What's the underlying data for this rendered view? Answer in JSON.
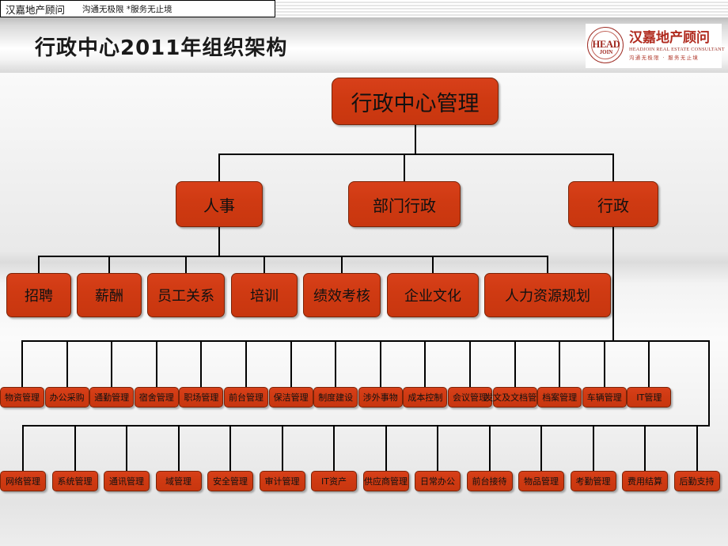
{
  "header": {
    "brand": "汉嘉地产顾问",
    "slogan": "沟通无极限 *服务无止境"
  },
  "title": "行政中心2011年组织架构",
  "logo": {
    "mark_top": "HEAD",
    "mark_bottom": "JOIN",
    "name_cn": "汉嘉地产顾问",
    "name_en": "HEADJOIN REAL ESTATE CONSULTANT",
    "slogan": "沟通无极限 · 服务无止境"
  },
  "colors": {
    "node_fill": "#CF3A12",
    "node_border": "#7A2408",
    "connector": "#000000",
    "title_text": "#1A1A1A",
    "brand_red": "#B02A1E"
  },
  "chart_data": {
    "type": "diagram",
    "title": "行政中心2011年组织架构",
    "levels": [
      {
        "level": 1,
        "nodes": [
          "行政中心管理"
        ]
      },
      {
        "level": 2,
        "nodes": [
          "人事",
          "部门行政",
          "行政"
        ]
      },
      {
        "level": 3,
        "parent": "人事",
        "nodes": [
          "招聘",
          "薪酬",
          "员工关系",
          "培训",
          "绩效考核",
          "企业文化",
          "人力资源规划"
        ]
      },
      {
        "level": 4,
        "parent": "行政",
        "nodes": [
          "物资管理",
          "办公采购",
          "通勤管理",
          "宿舍管理",
          "职场管理",
          "前台管理",
          "保洁管理",
          "制度建设",
          "涉外事物",
          "成本控制",
          "会议管理",
          "发文及文档管理",
          "档案管理",
          "车辆管理",
          "IT管理"
        ]
      },
      {
        "level": 5,
        "parent": "IT管理",
        "nodes": [
          "网络管理",
          "系统管理",
          "通讯管理",
          "域管理",
          "安全管理",
          "审计管理",
          "IT资产",
          "供应商管理",
          "日常办公",
          "前台接待",
          "物品管理",
          "考勤管理",
          "费用结算",
          "后勤支持"
        ]
      }
    ],
    "root": "行政中心管理",
    "level2": [
      {
        "label": "人事"
      },
      {
        "label": "部门行政"
      },
      {
        "label": "行政"
      }
    ],
    "level3": [
      {
        "label": "招聘"
      },
      {
        "label": "薪酬"
      },
      {
        "label": "员工关系"
      },
      {
        "label": "培训"
      },
      {
        "label": "绩效考核"
      },
      {
        "label": "企业文化"
      },
      {
        "label": "人力资源规划"
      }
    ],
    "level4": [
      {
        "label": "物资管理"
      },
      {
        "label": "办公采购"
      },
      {
        "label": "通勤管理"
      },
      {
        "label": "宿舍管理"
      },
      {
        "label": "职场管理"
      },
      {
        "label": "前台管理"
      },
      {
        "label": "保洁管理"
      },
      {
        "label": "制度建设"
      },
      {
        "label": "涉外事物"
      },
      {
        "label": "成本控制"
      },
      {
        "label": "会议管理"
      },
      {
        "label": "发文及文档管理"
      },
      {
        "label": "档案管理"
      },
      {
        "label": "车辆管理"
      },
      {
        "label": "IT管理"
      }
    ],
    "level5": [
      {
        "label": "网络管理"
      },
      {
        "label": "系统管理"
      },
      {
        "label": "通讯管理"
      },
      {
        "label": "域管理"
      },
      {
        "label": "安全管理"
      },
      {
        "label": "审计管理"
      },
      {
        "label": "IT资产"
      },
      {
        "label": "供应商管理"
      },
      {
        "label": "日常办公"
      },
      {
        "label": "前台接待"
      },
      {
        "label": "物品管理"
      },
      {
        "label": "考勤管理"
      },
      {
        "label": "费用结算"
      },
      {
        "label": "后勤支持"
      }
    ]
  }
}
